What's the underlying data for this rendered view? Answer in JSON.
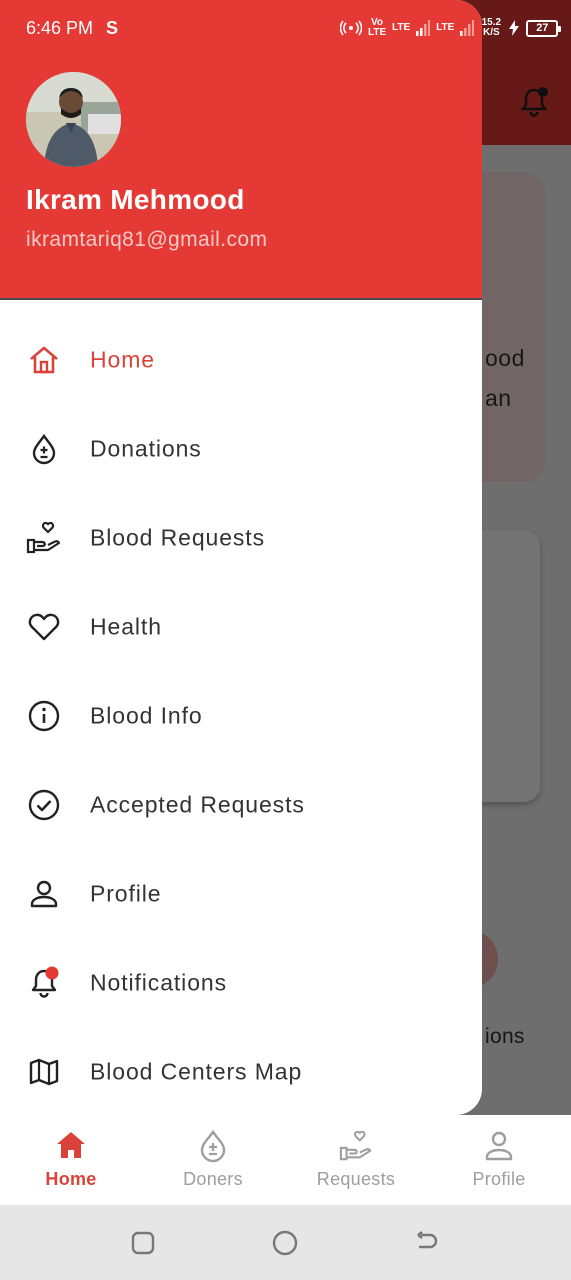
{
  "status_bar": {
    "time": "6:46 PM",
    "s_icon": "S",
    "volte": "Vo LTE",
    "lte1": "LTE",
    "lte2": "LTE",
    "speed": "15.2 K/S",
    "battery": "27"
  },
  "background": {
    "text_1": "ood",
    "text_2": "an",
    "text_3": "ions"
  },
  "profile": {
    "name": "Ikram Mehmood",
    "email": "ikramtariq81@gmail.com"
  },
  "menu": {
    "items": [
      {
        "label": "Home",
        "icon": "home-icon",
        "active": true
      },
      {
        "label": "Donations",
        "icon": "blood-drop-plus-minus-icon"
      },
      {
        "label": "Blood Requests",
        "icon": "hand-heart-icon"
      },
      {
        "label": "Health",
        "icon": "heart-icon"
      },
      {
        "label": "Blood Info",
        "icon": "info-icon"
      },
      {
        "label": "Accepted Requests",
        "icon": "check-circle-icon"
      },
      {
        "label": "Profile",
        "icon": "person-icon"
      },
      {
        "label": "Notifications",
        "icon": "bell-icon"
      },
      {
        "label": "Blood Centers Map",
        "icon": "map-icon"
      }
    ]
  },
  "bottom_nav": {
    "items": [
      {
        "label": "Home",
        "icon": "home-icon",
        "active": true
      },
      {
        "label": "Doners",
        "icon": "blood-drop-plus-minus-icon"
      },
      {
        "label": "Requests",
        "icon": "hand-heart-icon"
      },
      {
        "label": "Profile",
        "icon": "person-icon"
      }
    ]
  },
  "colors": {
    "primary": "#e53935",
    "active_text": "#d9433a",
    "inactive_nav": "#9e9e9e",
    "text": "#333333"
  }
}
